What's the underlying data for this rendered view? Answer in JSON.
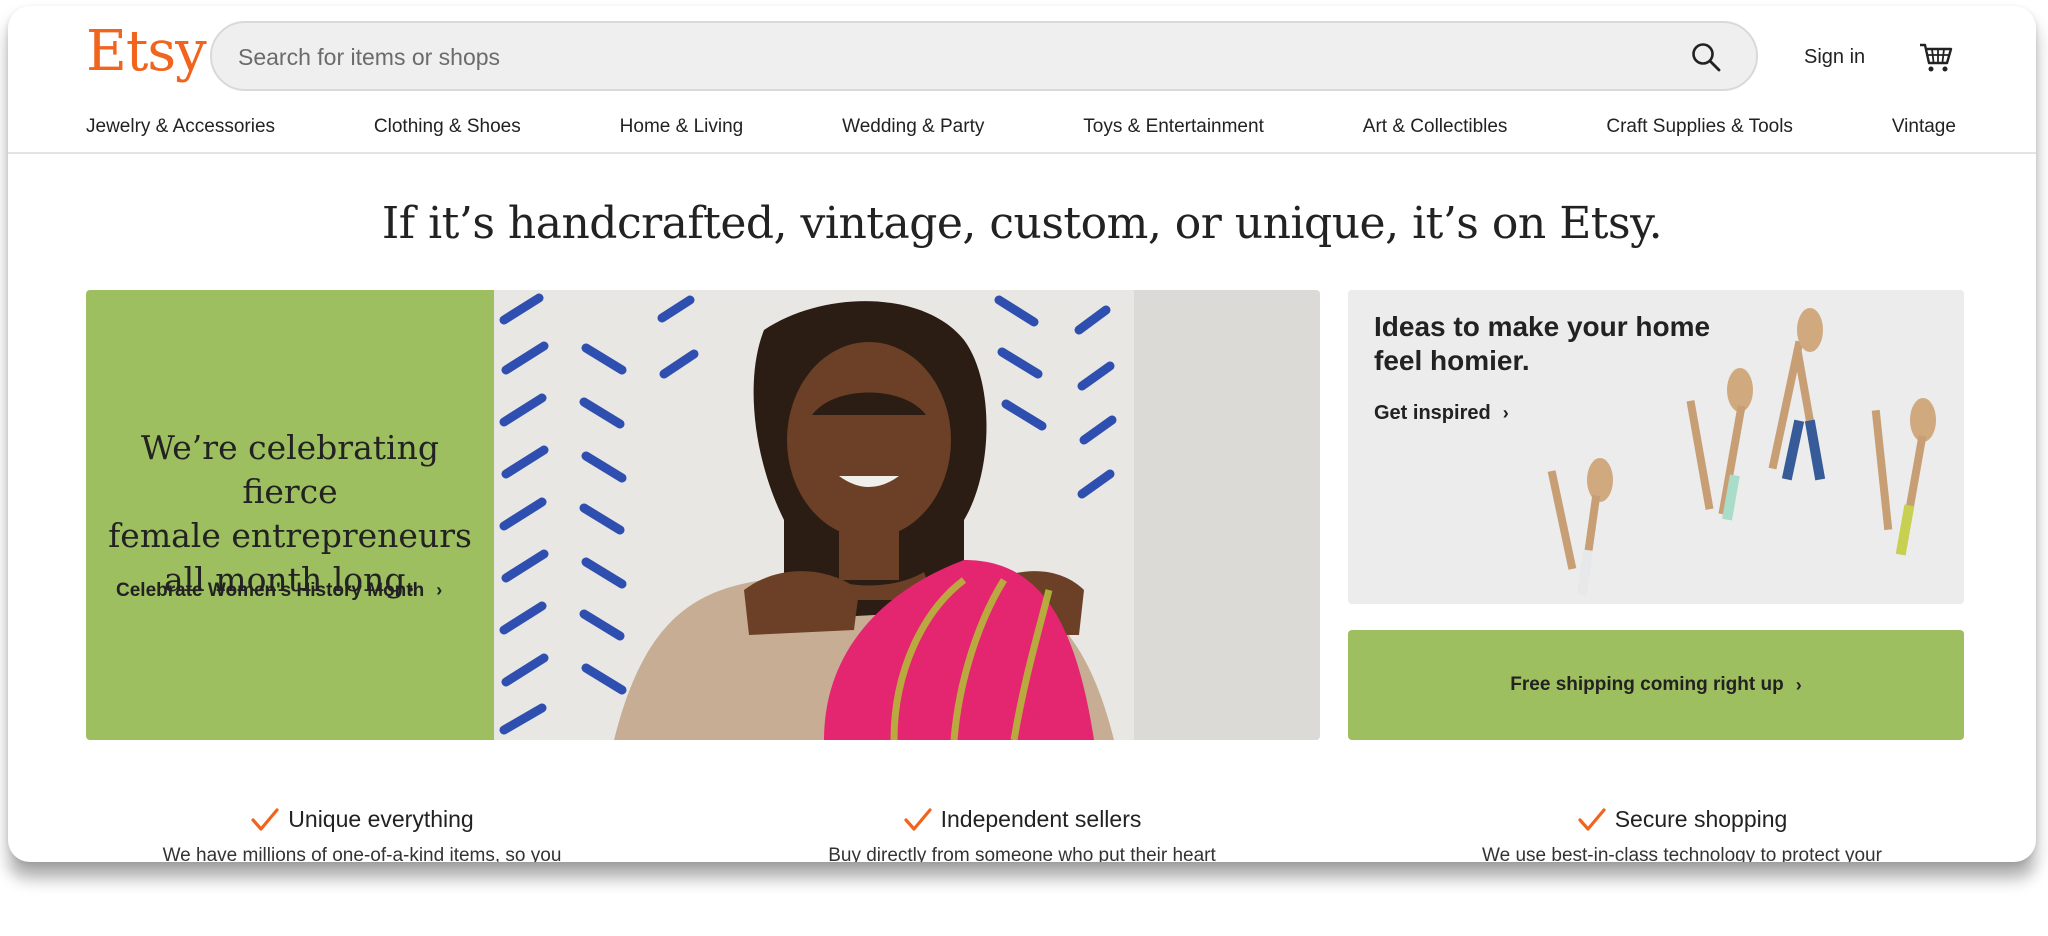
{
  "header": {
    "logo": "Etsy",
    "search_placeholder": "Search for items or shops",
    "sign_in": "Sign in"
  },
  "categories": [
    "Jewelry & Accessories",
    "Clothing & Shoes",
    "Home & Living",
    "Wedding & Party",
    "Toys & Entertainment",
    "Art & Collectibles",
    "Craft Supplies & Tools",
    "Vintage"
  ],
  "tagline": "If it’s handcrafted, vintage, custom, or unique, it’s on Etsy.",
  "hero": {
    "headline_lines": [
      "We’re celebrating fierce",
      "female entrepreneurs",
      "all month long."
    ],
    "cta": "Celebrate Women's History Month"
  },
  "home_card": {
    "title_lines": [
      "Ideas to make your home",
      "feel homier."
    ],
    "link": "Get inspired"
  },
  "shipping_banner": "Free shipping coming right up",
  "value_props": [
    {
      "title": "Unique everything",
      "desc": "We have millions of one-of-a-kind items, so you"
    },
    {
      "title": "Independent sellers",
      "desc": "Buy directly from someone who put their heart"
    },
    {
      "title": "Secure shopping",
      "desc": "We use best-in-class technology to protect your"
    }
  ],
  "colors": {
    "brand": "#f1641e",
    "green_banner": "#9ebf5f",
    "check": "#f1641e"
  }
}
